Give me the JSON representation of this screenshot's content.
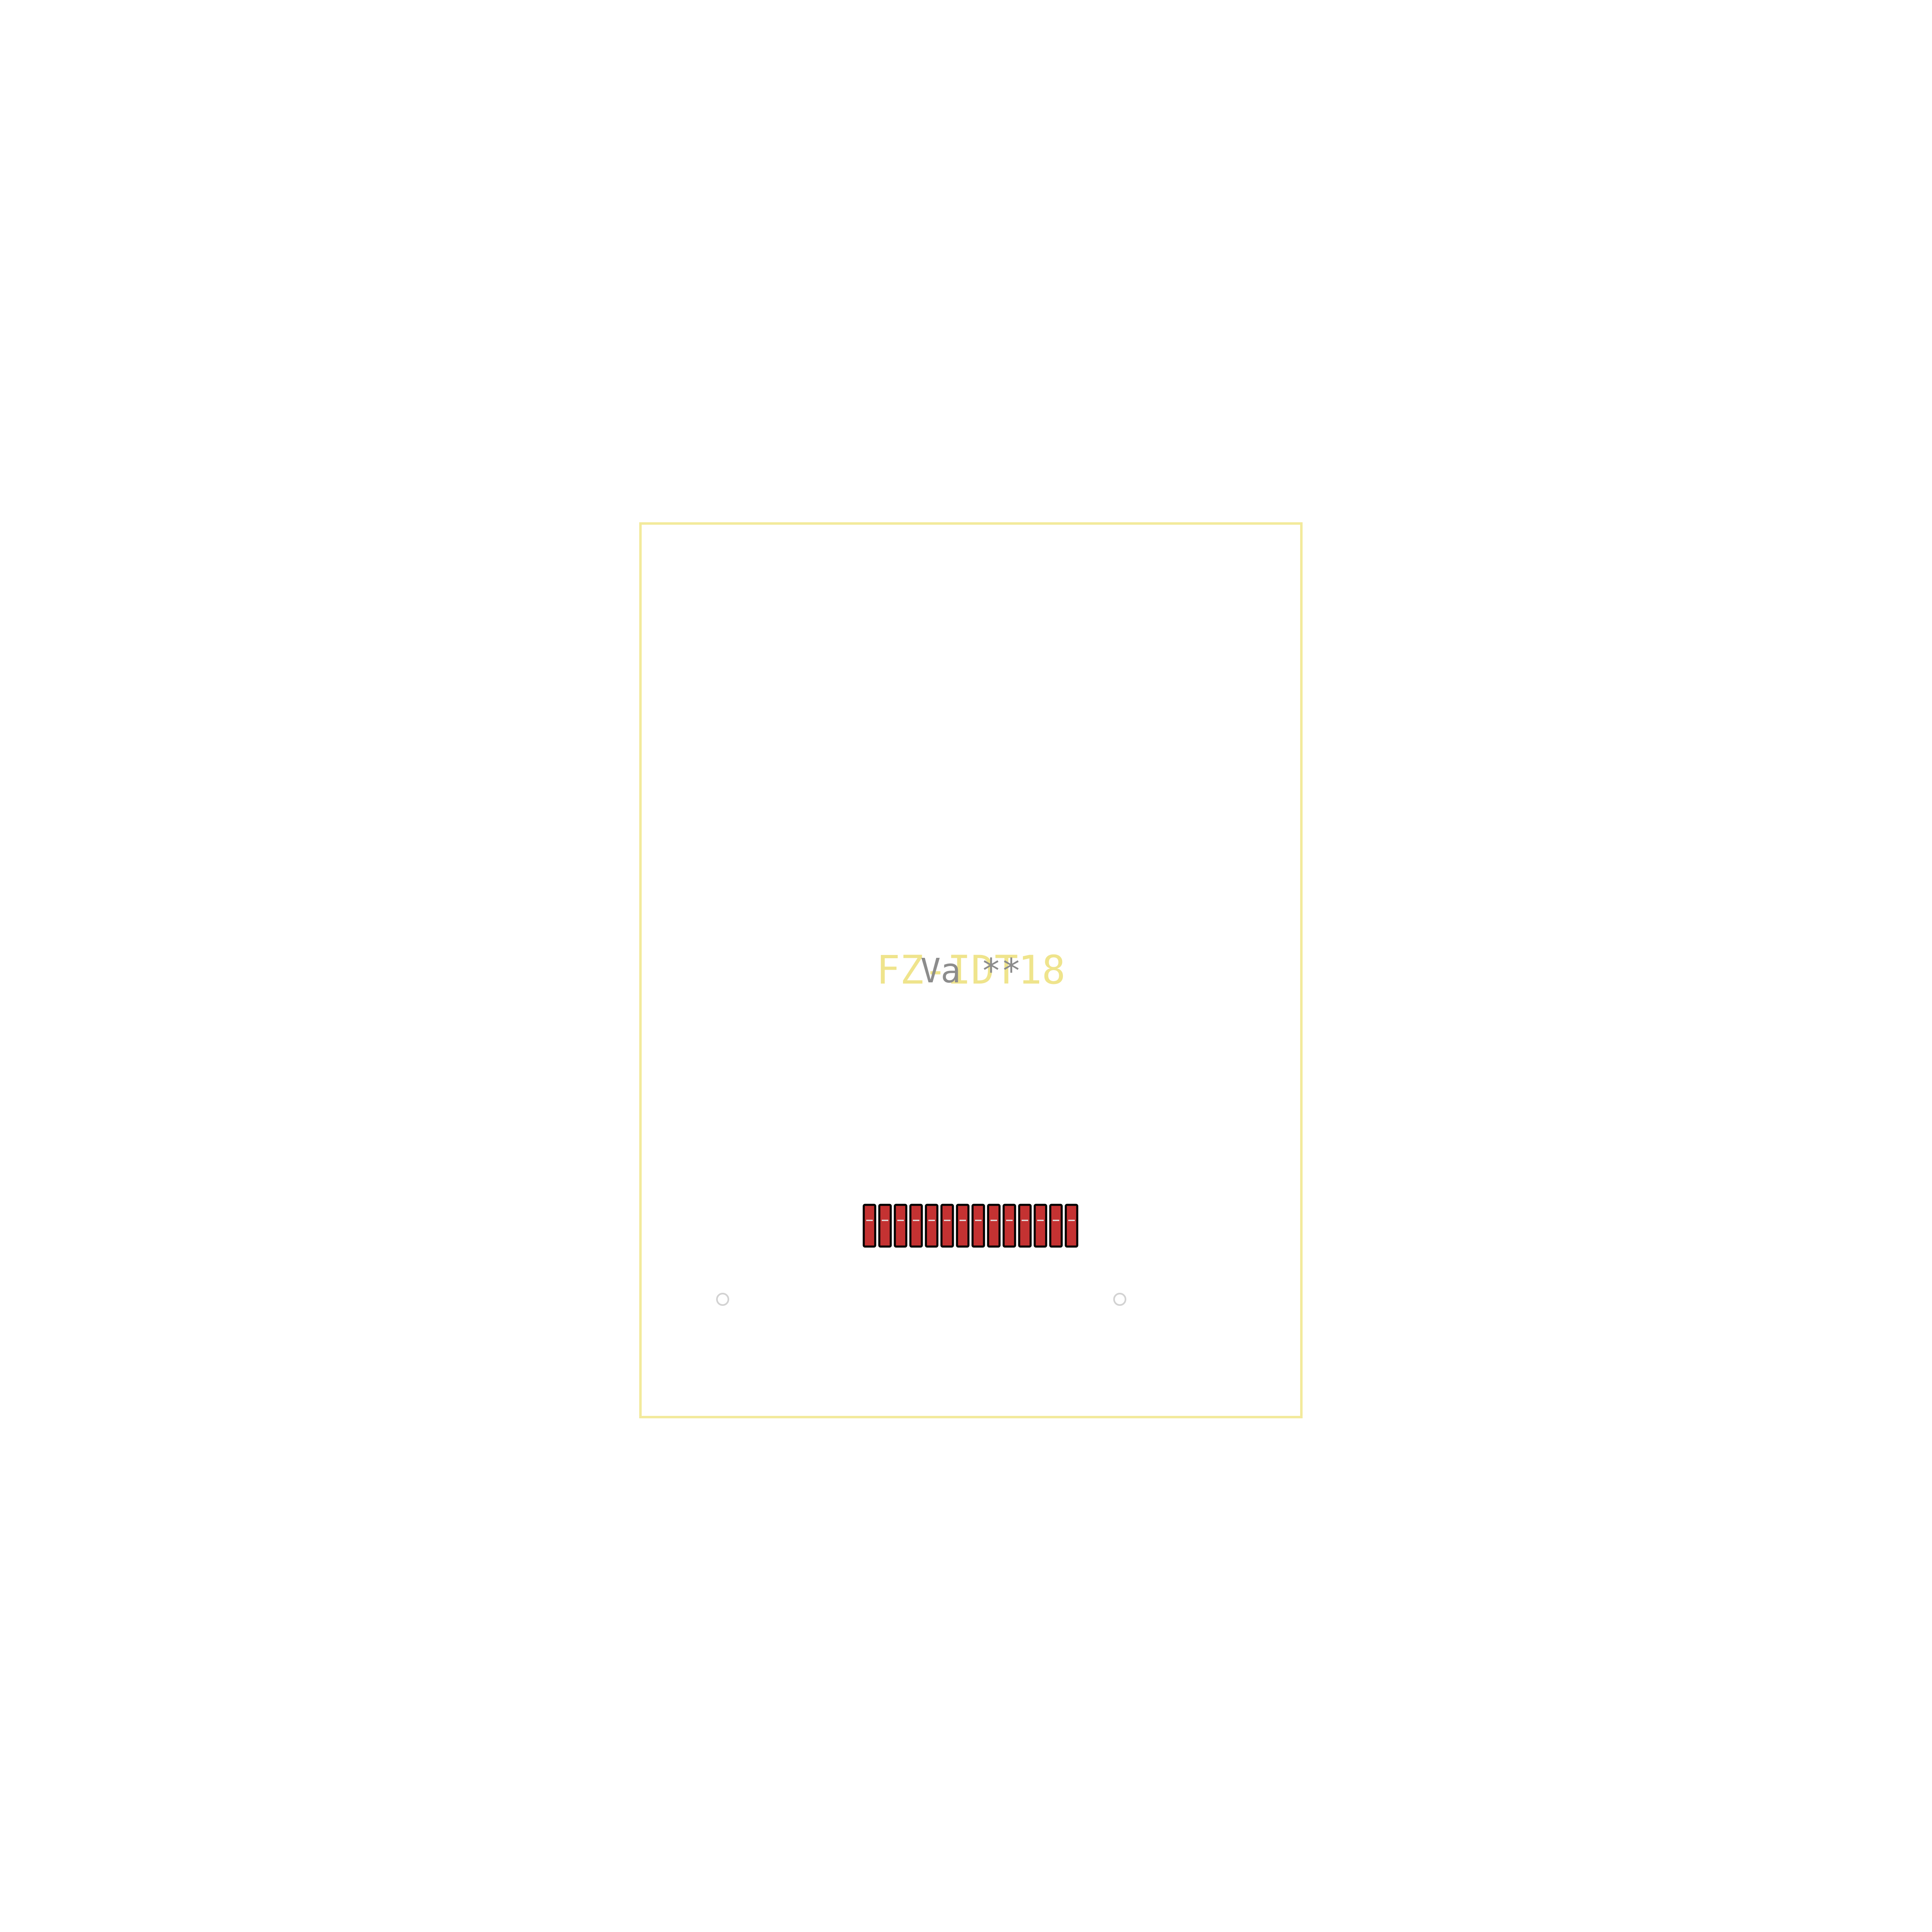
{
  "footprint": {
    "fab_value": "FZ-IDT18",
    "reference": "Va **",
    "pad_count": 14
  },
  "colors": {
    "background": "#ffffff",
    "courtyard": "#f3ea9c",
    "fab_text": "#efe48c",
    "ref_text": "#8c8c8c",
    "pad_fill": "#c43232",
    "pad_outline": "#000000",
    "pad_stripe": "#e6e6e6",
    "mounting_hole": "#d2d2d2"
  }
}
